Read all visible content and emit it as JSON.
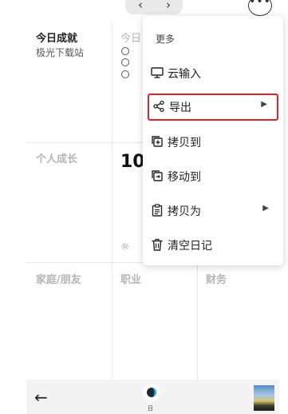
{
  "nav": {
    "prev": "‹",
    "next": "›",
    "more": "•••"
  },
  "grid": {
    "row1": {
      "c1_title": "今日成就",
      "c1_sub": "极光下载站",
      "c2_title": "今日"
    },
    "row2": {
      "c1_title": "个人成长",
      "c2_value": "10"
    },
    "row3": {
      "c1_title": "家庭/朋友",
      "c2_title": "职业",
      "c3_title": "财务"
    }
  },
  "menu": {
    "header": "更多",
    "items": [
      {
        "label": "云输入",
        "icon": "monitor-icon",
        "submenu": false
      },
      {
        "label": "导出",
        "icon": "share-icon",
        "submenu": true,
        "highlighted": true
      },
      {
        "label": "拷贝到",
        "icon": "copy-to-icon",
        "submenu": false
      },
      {
        "label": "移动到",
        "icon": "move-to-icon",
        "submenu": false
      },
      {
        "label": "拷贝为",
        "icon": "clipboard-icon",
        "submenu": true
      },
      {
        "label": "清空日记",
        "icon": "trash-icon",
        "submenu": false
      }
    ],
    "highlight_color": "#d9262f"
  },
  "bottom": {
    "back": "←",
    "day_label": "日"
  }
}
